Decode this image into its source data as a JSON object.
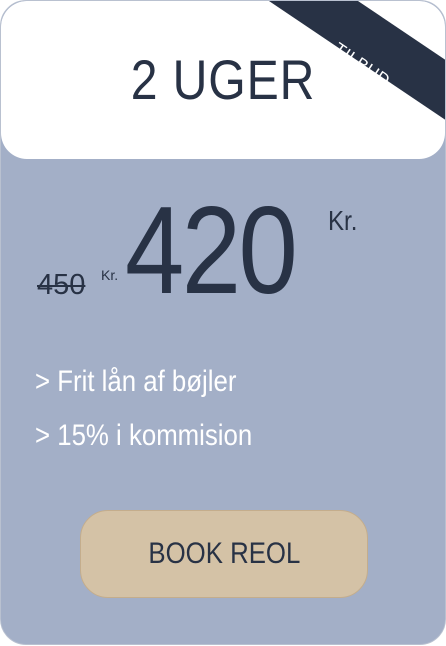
{
  "plan": {
    "title": "2 UGER",
    "badge": "TILBUD",
    "old_price": "450",
    "old_currency": "Kr.",
    "price": "420",
    "currency": "Kr.",
    "features": [
      "> Frit lån af bøjler",
      "> 15% i kommision"
    ],
    "button_label": "BOOK REOL"
  },
  "colors": {
    "card": "#a3afc7",
    "header": "#ffffff",
    "ribbon": "#283245",
    "button": "#d4c2a6",
    "text": "#283245"
  }
}
